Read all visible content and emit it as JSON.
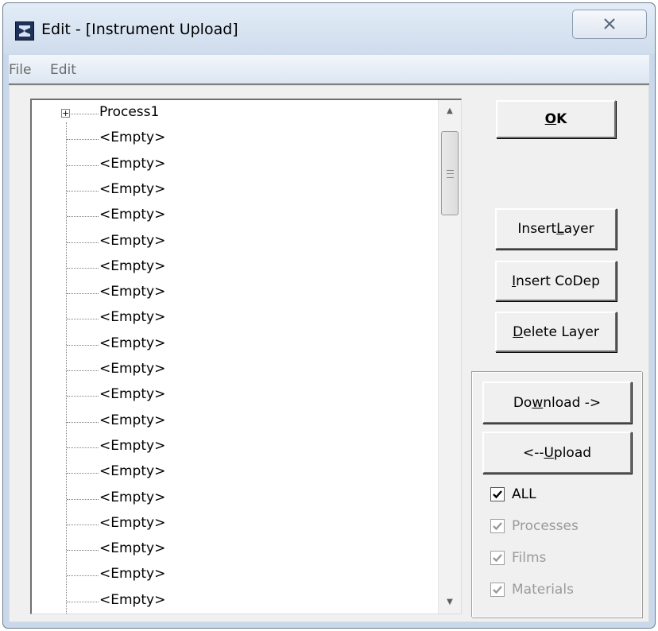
{
  "window": {
    "title": "Edit - [Instrument Upload]",
    "close_glyph": "✕"
  },
  "menu": [
    {
      "label": "File"
    },
    {
      "label": "Edit"
    }
  ],
  "tree": {
    "root": {
      "label": "Process1",
      "expander": "+"
    },
    "items": [
      "<Empty>",
      "<Empty>",
      "<Empty>",
      "<Empty>",
      "<Empty>",
      "<Empty>",
      "<Empty>",
      "<Empty>",
      "<Empty>",
      "<Empty>",
      "<Empty>",
      "<Empty>",
      "<Empty>",
      "<Empty>",
      "<Empty>",
      "<Empty>",
      "<Empty>",
      "<Empty>",
      "<Empty>"
    ],
    "scroll_up_glyph": "▲",
    "scroll_down_glyph": "▼"
  },
  "buttons": {
    "ok": {
      "pre": "",
      "mn": "O",
      "post": "K"
    },
    "insert_layer": {
      "pre": "Insert ",
      "mn": "L",
      "post": "ayer"
    },
    "insert_codep": {
      "pre": "",
      "mn": "I",
      "post": "nsert CoDep"
    },
    "delete_layer": {
      "pre": "",
      "mn": "D",
      "post": "elete Layer"
    },
    "download": {
      "pre": "Do",
      "mn": "w",
      "post": "nload ->"
    },
    "upload": {
      "pre": "<-- ",
      "mn": "U",
      "post": "pload"
    }
  },
  "checkboxes": [
    {
      "label": "ALL",
      "checked": true,
      "enabled": true
    },
    {
      "label": "Processes",
      "checked": true,
      "enabled": false
    },
    {
      "label": "Films",
      "checked": true,
      "enabled": false
    },
    {
      "label": "Materials",
      "checked": true,
      "enabled": false
    }
  ]
}
